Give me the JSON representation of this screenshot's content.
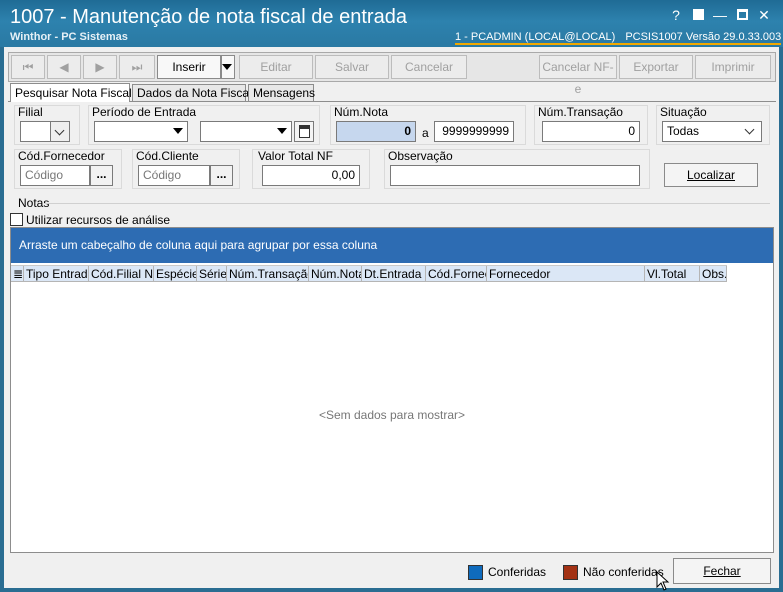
{
  "window": {
    "title": "1007 - Manutenção de nota fiscal de entrada",
    "subtitle": "Winthor - PC Sistemas",
    "connection": "1 - PCADMIN (LOCAL@LOCAL)",
    "module": "PCSIS1007  Versão  29.0.33.003",
    "help_glyph": "?",
    "minimize_glyph": "—",
    "close_glyph": "✕"
  },
  "toolbar": {
    "first": "⏮",
    "prev": "◀",
    "next": "▶",
    "last": "⏭",
    "inserir": "Inserir",
    "editar": "Editar",
    "salvar": "Salvar",
    "cancelar": "Cancelar",
    "cancelar_nfe": "Cancelar NF-e",
    "exportar": "Exportar",
    "imprimir": "Imprimir"
  },
  "tabs": [
    "Pesquisar Nota Fiscal",
    "Dados da Nota Fiscal",
    "Mensagens"
  ],
  "filters": {
    "filial_label": "Filial",
    "periodo_label": "Período de Entrada",
    "num_nota_label": "Núm.Nota",
    "num_nota_from": "0",
    "num_nota_sep": "a",
    "num_nota_to": "9999999999",
    "num_transacao_label": "Núm.Transação",
    "num_transacao_value": "0",
    "situacao_label": "Situação",
    "situacao_value": "Todas",
    "cod_fornecedor_label": "Cód.Fornecedor",
    "cod_fornecedor_placeholder": "Código",
    "cod_cliente_label": "Cód.Cliente",
    "cod_cliente_placeholder": "Código",
    "ellipsis": "...",
    "valor_total_label": "Valor Total NF",
    "valor_total_value": "0,00",
    "observacao_label": "Observação",
    "observacao_value": "",
    "localizar": "Localizar"
  },
  "notas": {
    "section_label": "Notas",
    "analise_label": "Utilizar recursos de análise",
    "group_hint": "Arraste um cabeçalho de coluna aqui para agrupar por essa coluna",
    "columns": [
      "Tipo Entrada",
      "Cód.Filial NF",
      "Espécie",
      "Série",
      "Núm.Transação",
      "Núm.Nota",
      "Dt.Entrada",
      "Cód.Fornec",
      "Fornecedor",
      "Vl.Total",
      "Obs."
    ],
    "empty_text": "<Sem dados para mostrar>"
  },
  "footer": {
    "conferidas": "Conferidas",
    "nao_conferidas": "Não conferidas",
    "fechar": "Fechar"
  },
  "colors": {
    "conferidas": "#0f6bbd",
    "nao_conferidas": "#a33214",
    "group_bar": "#2d6cb3",
    "title_bar": "#2a79a3"
  }
}
